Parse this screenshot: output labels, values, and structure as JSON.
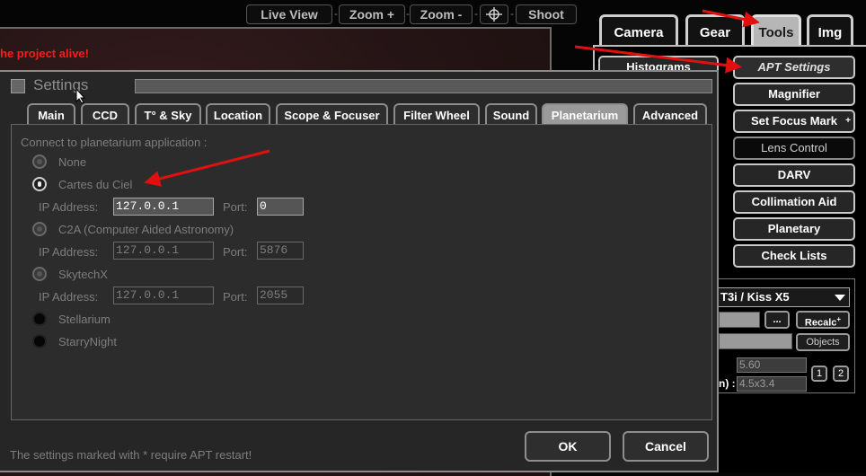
{
  "toolbar": {
    "live_view": "Live View",
    "zoom_in": "Zoom +",
    "zoom_out": "Zoom -",
    "crosshair_icon": "crosshair-icon",
    "shoot": "Shoot",
    "separator": "-"
  },
  "banner_text": "he project alive!",
  "right_panel": {
    "tabs": [
      {
        "label": "Camera",
        "active": false
      },
      {
        "label": "Gear",
        "active": false
      },
      {
        "label": "Tools",
        "active": true
      },
      {
        "label": "Img",
        "active": false
      }
    ],
    "histograms": "Histograms",
    "buttons": {
      "apt_settings": "APT Settings",
      "magnifier": "Magnifier",
      "set_focus_mark": "Set Focus Mark",
      "lens_control": "Lens Control",
      "darv": "DARV",
      "collimation_aid": "Collimation Aid",
      "planetary": "Planetary",
      "check_lists": "Check Lists"
    },
    "plus_mark": "+",
    "camera_model": "T3i / Kiss X5",
    "ellipsis": "...",
    "recalc": "Recalc",
    "objects": "Objects",
    "value_1": "5.60",
    "value_2": "4.5x3.4",
    "label_fragment": "n) :",
    "num_1": "1",
    "num_2": "2"
  },
  "settings": {
    "title": "Settings",
    "tabs": [
      {
        "label": "Main",
        "active": false
      },
      {
        "label": "CCD",
        "active": false
      },
      {
        "label": "T° & Sky",
        "active": false
      },
      {
        "label": "Location",
        "active": false
      },
      {
        "label": "Scope & Focuser",
        "active": false
      },
      {
        "label": "Filter Wheel",
        "active": false
      },
      {
        "label": "Sound",
        "active": false
      },
      {
        "label": "Planetarium",
        "active": true
      },
      {
        "label": "Advanced",
        "active": false
      }
    ],
    "connect_label": "Connect to planetarium application :",
    "options": [
      {
        "label": "None",
        "state": "disabled"
      },
      {
        "label": "Cartes du Ciel",
        "state": "selected"
      },
      {
        "label": "C2A (Computer Aided Astronomy)",
        "state": "disabled"
      },
      {
        "label": "SkytechX",
        "state": "disabled"
      },
      {
        "label": "Stellarium",
        "state": "enabled"
      },
      {
        "label": "StarryNight",
        "state": "enabled"
      }
    ],
    "ip_label": "IP Address:",
    "port_label": "Port:",
    "connections": [
      {
        "ip": "127.0.0.1",
        "port": "0",
        "active": true
      },
      {
        "ip": "127.0.0.1",
        "port": "5876",
        "active": false
      },
      {
        "ip": "127.0.0.1",
        "port": "2055",
        "active": false
      }
    ],
    "footnote": "The settings marked with * require APT restart!",
    "ok": "OK",
    "cancel": "Cancel"
  },
  "colors": {
    "annotation_arrow": "#e01010",
    "banner": "#ff1a1a"
  }
}
